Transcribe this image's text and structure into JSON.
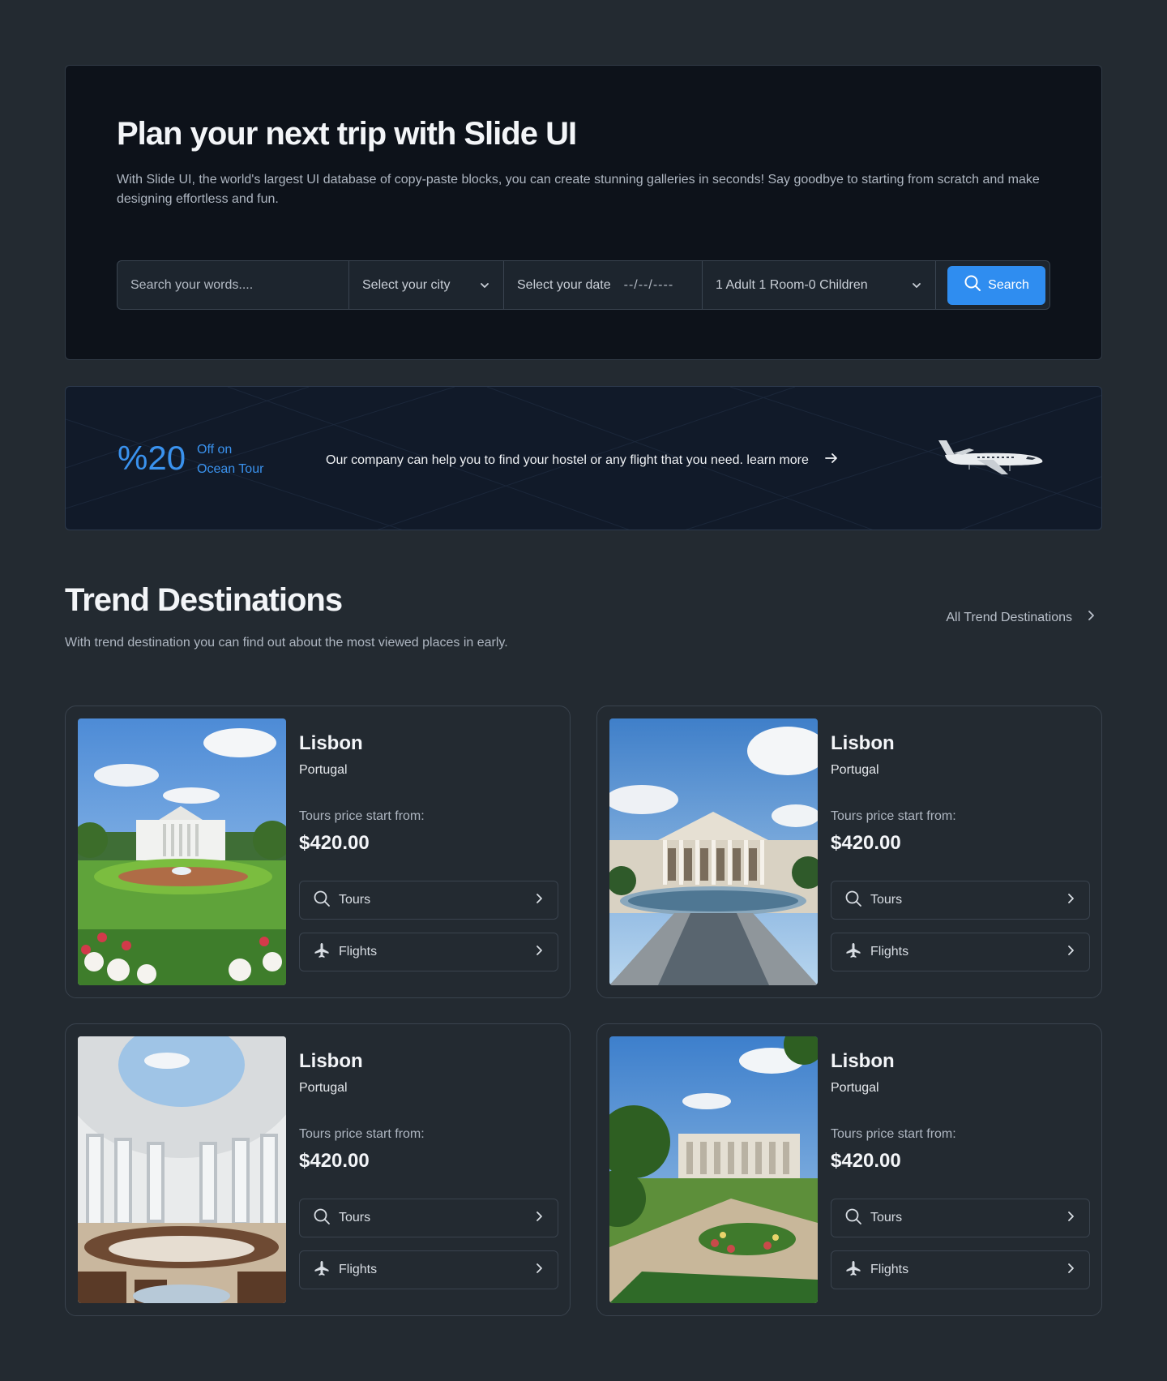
{
  "hero": {
    "title": "Plan your next trip with Slide UI",
    "description": "With Slide UI, the world's largest UI database of copy-paste blocks, you can create stunning galleries in seconds! Say goodbye to starting from scratch and make designing effortless and fun.",
    "search": {
      "placeholder": "Search your words....",
      "city": "Select your city",
      "date_label": "Select your date",
      "date_value": "--/--/----",
      "guests": "1 Adult 1 Room-0 Children",
      "button": "Search"
    }
  },
  "promo": {
    "percent": "%20",
    "off_line1": "Off on",
    "off_line2": "Ocean Tour",
    "text": "Our company can help you to find your hostel or any flight that you need. learn more"
  },
  "trends": {
    "title": "Trend Destinations",
    "subtitle": "With trend destination you can find out about the most viewed places in early.",
    "all_link": "All Trend Destinations",
    "cards": [
      {
        "city": "Lisbon",
        "country": "Portugal",
        "price_label": "Tours price start from:",
        "price": "$420.00",
        "tours": "Tours",
        "flights": "Flights"
      },
      {
        "city": "Lisbon",
        "country": "Portugal",
        "price_label": "Tours price start from:",
        "price": "$420.00",
        "tours": "Tours",
        "flights": "Flights"
      },
      {
        "city": "Lisbon",
        "country": "Portugal",
        "price_label": "Tours price start from:",
        "price": "$420.00",
        "tours": "Tours",
        "flights": "Flights"
      },
      {
        "city": "Lisbon",
        "country": "Portugal",
        "price_label": "Tours price start from:",
        "price": "$420.00",
        "tours": "Tours",
        "flights": "Flights"
      }
    ]
  },
  "colors": {
    "page_bg": "#232a31",
    "hero_bg": "#0d121a",
    "promo_bg": "#111a29",
    "accent": "#2f8df0"
  },
  "icons": [
    "search-icon",
    "chevron-down-icon",
    "arrow-right-icon",
    "chevron-right-icon",
    "plane-icon",
    "airplane-image"
  ]
}
